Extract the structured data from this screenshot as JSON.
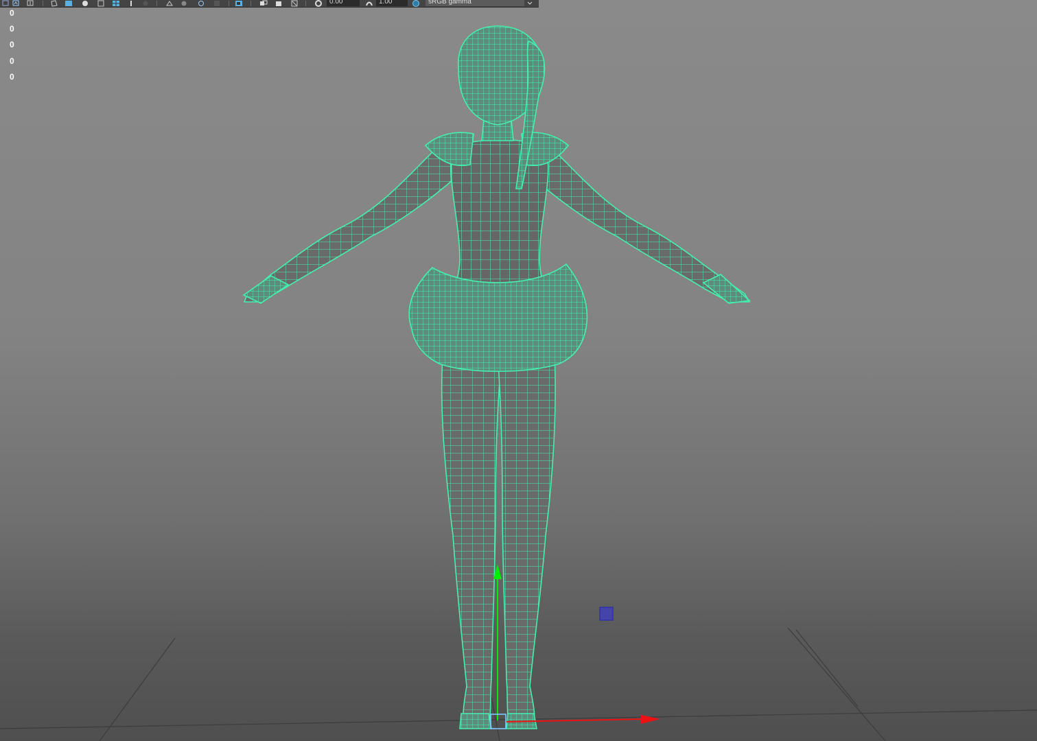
{
  "toolbar": {
    "exposure_value": "0.00",
    "gamma_value": "1.00",
    "color_space": "sRGB gamma",
    "icons": [
      "camera-select-icon",
      "camera-attributes-icon",
      "bookmark-icon",
      "image-plane-icon",
      "grid-icon",
      "film-gate-icon",
      "resolution-gate-icon",
      "wireframe-icon",
      "smooth-shade-icon",
      "default-lighting-icon",
      "textured-icon",
      "use-all-lights-icon",
      "shadows-icon",
      "screen-space-ao-icon",
      "motion-blur-icon",
      "anti-aliasing-icon",
      "depth-of-field-icon",
      "isolate-select-icon",
      "xray-icon",
      "xray-active-components-icon",
      "xray-joints-icon",
      "exposure-icon",
      "gamma-icon",
      "color-management-icon",
      "dropdown-arrow-icon"
    ]
  },
  "hud": {
    "values": [
      "0",
      "0",
      "0",
      "0",
      "0"
    ]
  },
  "colors": {
    "wireframe": "#45f0b0",
    "mesh_fill": "#6c6c6c",
    "axis_y": "#00ee00",
    "axis_x": "#ee1111",
    "manipulator_center": "#7ec8ff",
    "light_marker": "#4444aa",
    "grid": "#3c3c3c"
  }
}
